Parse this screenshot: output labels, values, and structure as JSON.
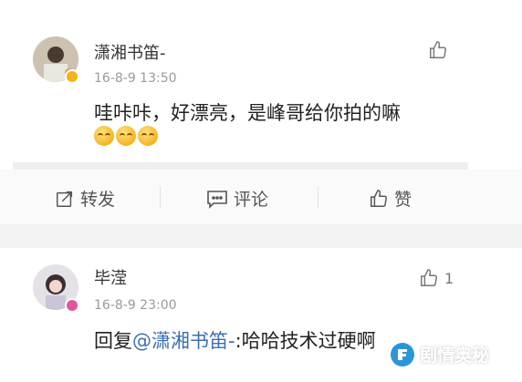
{
  "comments": [
    {
      "username": "潇湘书笛-",
      "time": "16-8-9 13:50",
      "text": "哇咔咔，好漂亮，是峰哥给你拍的嘛",
      "emojis": 3,
      "like_count": ""
    },
    {
      "username": "毕滢",
      "time": "16-8-9 23:00",
      "reply_prefix": "回复",
      "mention": "@潇湘书笛-",
      "reply_rest": ":哈哈技术过硬啊",
      "like_count": "1"
    }
  ],
  "actions": {
    "repost": "转发",
    "comment": "评论",
    "like": "赞"
  },
  "watermark": "剧情奥秘",
  "colors": {
    "mention": "#3b6fb4",
    "badge_gold": "#f3b417",
    "badge_pink": "#e0569a",
    "watermark": "#2c95d8"
  }
}
